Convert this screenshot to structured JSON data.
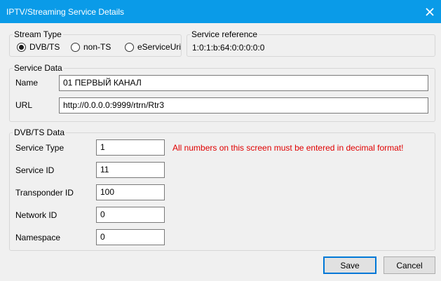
{
  "window": {
    "title": "IPTV/Streaming Service Details"
  },
  "stream_type": {
    "legend": "Stream Type",
    "options": [
      {
        "label": "DVB/TS",
        "selected": true
      },
      {
        "label": "non-TS",
        "selected": false
      },
      {
        "label": "eServiceUri",
        "selected": false
      }
    ]
  },
  "service_reference": {
    "legend": "Service reference",
    "value": "1:0:1:b:64:0:0:0:0:0"
  },
  "service_data": {
    "legend": "Service Data",
    "name_label": "Name",
    "name_value": "01 ПЕРВЫЙ КАНАЛ",
    "url_label": "URL",
    "url_value": "http://0.0.0.0:9999/rtrn/Rtr3"
  },
  "dvb_ts_data": {
    "legend": "DVB/TS Data",
    "warning": "All numbers on this screen must be entered in decimal format!",
    "fields": [
      {
        "label": "Service Type",
        "value": "1"
      },
      {
        "label": "Service ID",
        "value": "11"
      },
      {
        "label": "Transponder ID",
        "value": "100"
      },
      {
        "label": "Network ID",
        "value": "0"
      },
      {
        "label": "Namespace",
        "value": "0"
      }
    ]
  },
  "buttons": {
    "save": "Save",
    "cancel": "Cancel"
  },
  "colors": {
    "titlebar": "#0a9be8",
    "warning": "#e00000"
  }
}
